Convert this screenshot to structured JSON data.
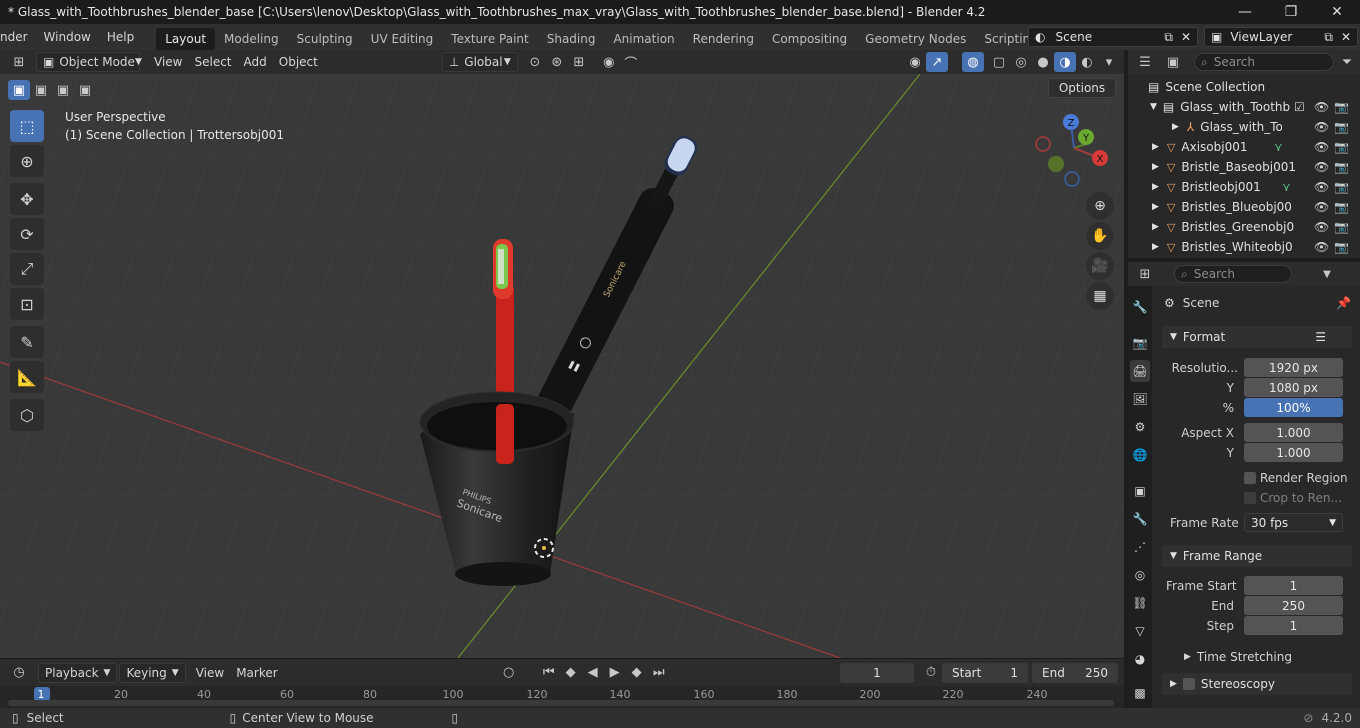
{
  "window": {
    "title": "* Glass_with_Toothbrushes_blender_base [C:\\Users\\lenov\\Desktop\\Glass_with_Toothbrushes_max_vray\\Glass_with_Toothbrushes_blender_base.blend] - Blender 4.2",
    "minimize": "—",
    "maximize": "❐",
    "close": "✕"
  },
  "menu": [
    "nder",
    "Window",
    "Help"
  ],
  "workspaces": [
    "Layout",
    "Modeling",
    "Sculpting",
    "UV Editing",
    "Texture Paint",
    "Shading",
    "Animation",
    "Rendering",
    "Compositing",
    "Geometry Nodes",
    "Scripting"
  ],
  "scene_name": "Scene",
  "view_layer": "ViewLayer",
  "viewport_header": {
    "mode": "Object Mode",
    "menus": [
      "View",
      "Select",
      "Add",
      "Object"
    ],
    "orientation": "Global",
    "options_label": "Options"
  },
  "viewport": {
    "perspective": "User Perspective",
    "collection_info": "(1) Scene Collection | Trottersobj001",
    "gizmo_axes": [
      "X",
      "Y",
      "Z"
    ],
    "bristle_color": "#e83a2c",
    "brush_red": "#d8261c",
    "electric_brush": "#151515",
    "cup_text_1": "PHILIPS",
    "cup_text_2": "Sonicare",
    "brush_text": "Sonicare"
  },
  "timeline": {
    "menus": [
      "Playback",
      "Keying",
      "View",
      "Marker"
    ],
    "current_frame": "1",
    "start_label": "Start",
    "start_value": "1",
    "end_label": "End",
    "end_value": "250",
    "ticks": [
      "1",
      "20",
      "40",
      "60",
      "80",
      "100",
      "120",
      "140",
      "160",
      "180",
      "200",
      "220",
      "240"
    ]
  },
  "statusbar": {
    "select": "Select",
    "center_view": "Center View to Mouse",
    "version": "4.2.0"
  },
  "outliner": {
    "search_placeholder": "Search",
    "root": "Scene Collection",
    "rows": [
      {
        "name": "Glass_with_Toothb",
        "indent": 1
      },
      {
        "name": "Glass_with_Toc",
        "indent": 2
      },
      {
        "name": "Axisobj001",
        "indent": 1
      },
      {
        "name": "Bristle_Baseobj001",
        "indent": 1
      },
      {
        "name": "Bristleobj001",
        "indent": 1
      },
      {
        "name": "Bristles_Blueobj00",
        "indent": 1
      },
      {
        "name": "Bristles_Greenobj0",
        "indent": 1
      },
      {
        "name": "Bristles_Whiteobj0",
        "indent": 1
      }
    ]
  },
  "properties": {
    "search_placeholder": "Search",
    "context": "Scene",
    "format_panel": "Format",
    "resolution_label": "Resolutio...",
    "res_x": "1920 px",
    "y_label": "Y",
    "res_y": "1080 px",
    "percent_label": "%",
    "res_percent": "100%",
    "aspect_x_label": "Aspect X",
    "aspect_x": "1.000",
    "aspect_y_label": "Y",
    "aspect_y": "1.000",
    "render_region": "Render Region",
    "crop_to_render": "Crop to Ren...",
    "frame_rate_label": "Frame Rate",
    "frame_rate": "30 fps",
    "frame_range_panel": "Frame Range",
    "frame_start_label": "Frame Start",
    "frame_start": "1",
    "end_label": "End",
    "frame_end": "250",
    "step_label": "Step",
    "frame_step": "1",
    "time_stretching": "Time Stretching",
    "stereoscopy": "Stereoscopy"
  }
}
